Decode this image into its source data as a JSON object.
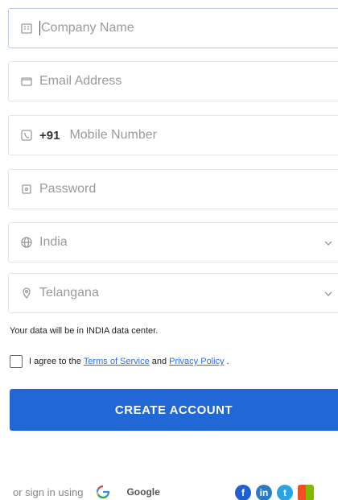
{
  "form": {
    "company_name": {
      "value": "Company Name",
      "icon": "building-icon"
    },
    "email": {
      "placeholder": "Email Address",
      "icon": "envelope-icon"
    },
    "mobile": {
      "prefix": "+91",
      "placeholder": "Mobile Number",
      "icon": "phone-icon"
    },
    "password": {
      "placeholder": "Password",
      "icon": "lock-icon"
    },
    "country": {
      "value": "India",
      "icon": "globe-icon"
    },
    "state": {
      "value": "Telangana",
      "icon": "location-pin-icon"
    }
  },
  "data_center_note": "Your data will be in INDIA data center.",
  "agreement": {
    "prefix": "I agree to the",
    "terms_link": "Terms of Service",
    "conjunction": "and",
    "privacy_link": "Privacy Policy",
    "suffix": "."
  },
  "create_button": "CREATE ACCOUNT",
  "signin": {
    "label": "or sign in using",
    "google_label": "Google"
  },
  "colors": {
    "primary": "#2167d6",
    "link": "#2d6ee6",
    "facebook": "#1f5fd1",
    "linkedin": "#2a7bc2",
    "twitter": "#2aa3e3"
  }
}
